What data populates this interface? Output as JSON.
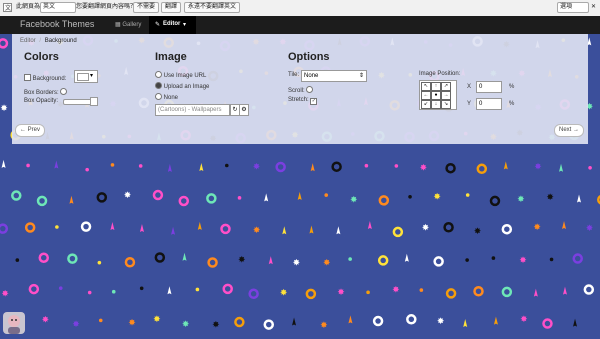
{
  "translate_bar": {
    "label_prefix": "此網頁為",
    "source_lang": "英文",
    "question": "您要翻譯網頁內容嗎？",
    "no_button": "不需要",
    "translate_button": "翻譯",
    "never_button": "永遠不要翻譯英文",
    "options_label": "選項"
  },
  "navbar": {
    "brand": "Facebook Themes",
    "gallery": "Gallery",
    "editor": "Editor"
  },
  "breadcrumb": {
    "root": "Editor",
    "sep": "/",
    "current": "Background"
  },
  "colors": {
    "title": "Colors",
    "background_label": "Background:",
    "box_borders_label": "Box Borders:",
    "box_opacity_label": "Box Opacity:"
  },
  "image": {
    "title": "Image",
    "opt_url": "Use Image URL",
    "opt_upload": "Upload an Image",
    "opt_none": "None",
    "select_value": "(Cartoons) - Wallpapers"
  },
  "options": {
    "title": "Options",
    "tile_label": "Tile:",
    "tile_value": "None",
    "scroll_label": "Scroll:",
    "stretch_label": "Stretch:",
    "position_label": "Image Position:",
    "x_label": "X",
    "x_value": "0",
    "y_label": "Y",
    "y_value": "0",
    "unit": "%"
  },
  "pager": {
    "prev": "← Prev",
    "next": "Next →"
  },
  "colors_palette": {
    "bg": "#3b4f9b",
    "panel": "#dee2f2",
    "nav": "#1c1c1c"
  }
}
